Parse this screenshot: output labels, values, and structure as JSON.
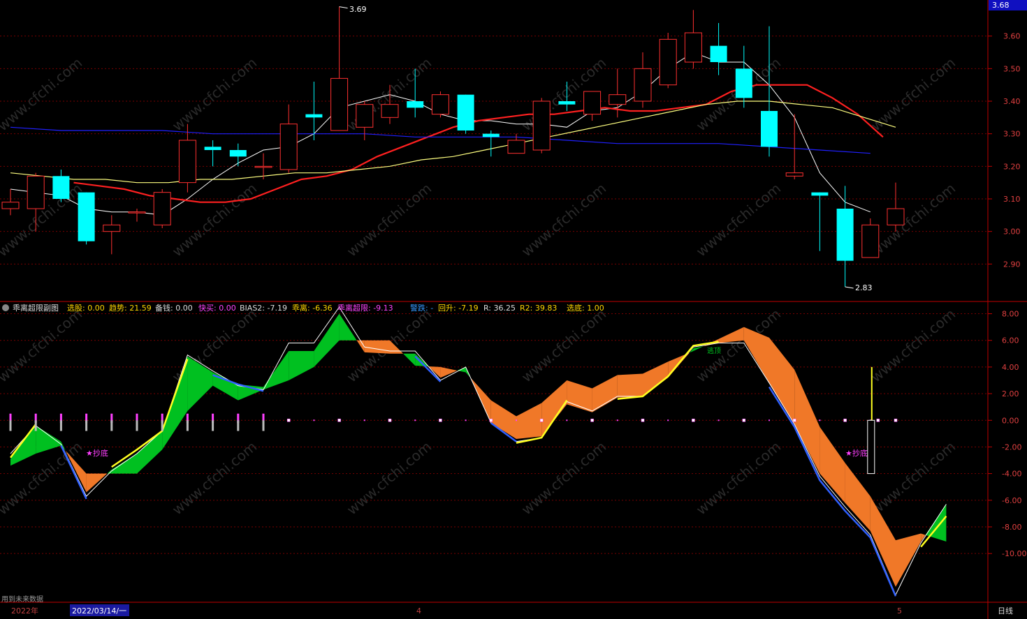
{
  "top_axis": {
    "current_price_box": "3.68",
    "ticks": [
      "3.60",
      "3.50",
      "3.40",
      "3.30",
      "3.20",
      "3.10",
      "3.00",
      "2.90"
    ],
    "tick_values": [
      3.6,
      3.5,
      3.4,
      3.3,
      3.2,
      3.1,
      3.0,
      2.9
    ],
    "ylim": [
      2.8,
      3.7
    ]
  },
  "bottom_axis": {
    "ticks": [
      "8.00",
      "6.00",
      "4.00",
      "2.00",
      "0.00",
      "-2.00",
      "-4.00",
      "-6.00",
      "-8.00",
      "-10.00"
    ],
    "tick_values": [
      8,
      6,
      4,
      2,
      0,
      -2,
      -4,
      -6,
      -8,
      -10
    ],
    "ylim": [
      -13.5,
      8.5
    ]
  },
  "indicator_header": {
    "name": "乖离超限副图",
    "items": [
      {
        "label": "选股:",
        "value": "0.00",
        "color": "#ffd700"
      },
      {
        "label": "趋势:",
        "value": "21.59",
        "color": "#ffd700"
      },
      {
        "label": "备钱:",
        "value": "0.00",
        "color": "#dddddd"
      },
      {
        "label": "快买:",
        "value": "0.00",
        "color": "#ff44ff"
      },
      {
        "label": "BIAS2:",
        "value": "-7.19",
        "color": "#dddddd"
      },
      {
        "label": "乖离:",
        "value": "-6.36",
        "color": "#ffd700"
      },
      {
        "label": "乖离超限:",
        "value": "-9.13",
        "color": "#ff44ff"
      },
      {
        "label": "警跌:",
        "value": "-",
        "color": "#3399ff"
      },
      {
        "label": "回升:",
        "value": "-7.19",
        "color": "#ffd700"
      },
      {
        "label": "R:",
        "value": "36.25",
        "color": "#dddddd"
      },
      {
        "label": "R2:",
        "value": "39.83",
        "color": "#ffd700"
      },
      {
        "label": "选底:",
        "value": "1.00",
        "color": "#ffd700"
      }
    ]
  },
  "annotations": {
    "high_label": "3.69",
    "low_label": "2.83",
    "buy_signal_1": "★抄底",
    "buy_signal_2": "★抄底",
    "top_signal": "逃顶",
    "future_data_note": "用到未来数据",
    "watermark": "www.cfchi.com"
  },
  "time_axis": {
    "year_label": "2022年",
    "cursor_date": "2022/03/14/一",
    "month_label_1": "4",
    "month_label_2": "5",
    "period_label": "日线"
  },
  "colors": {
    "up": "#ff3030",
    "down": "#00ffff",
    "ma5": "#ffffff",
    "ma10": "#ff2020",
    "ma20": "#ffff80",
    "ma60": "#2020ff",
    "orange": "#f07828",
    "green": "#00c020",
    "yellow": "#ffff20",
    "blue": "#3060ff",
    "magenta": "#ff40ff",
    "axis_red": "#c00000",
    "grid": "#7a0000"
  },
  "chart_data": [
    {
      "type": "candlestick",
      "series": [
        {
          "name": "candles",
          "values": [
            {
              "o": 3.07,
              "h": 3.13,
              "l": 3.05,
              "c": 3.09
            },
            {
              "o": 3.07,
              "h": 3.18,
              "l": 3.0,
              "c": 3.17
            },
            {
              "o": 3.17,
              "h": 3.19,
              "l": 3.09,
              "c": 3.1
            },
            {
              "o": 3.12,
              "h": 3.12,
              "l": 2.96,
              "c": 2.97
            },
            {
              "o": 3.0,
              "h": 3.05,
              "l": 2.93,
              "c": 3.02
            },
            {
              "o": 3.06,
              "h": 3.07,
              "l": 3.03,
              "c": 3.06
            },
            {
              "o": 3.02,
              "h": 3.13,
              "l": 3.01,
              "c": 3.12
            },
            {
              "o": 3.15,
              "h": 3.33,
              "l": 3.12,
              "c": 3.28
            },
            {
              "o": 3.26,
              "h": 3.28,
              "l": 3.2,
              "c": 3.25
            },
            {
              "o": 3.25,
              "h": 3.27,
              "l": 3.2,
              "c": 3.23
            },
            {
              "o": 3.2,
              "h": 3.24,
              "l": 3.16,
              "c": 3.2
            },
            {
              "o": 3.19,
              "h": 3.39,
              "l": 3.18,
              "c": 3.33
            },
            {
              "o": 3.36,
              "h": 3.46,
              "l": 3.28,
              "c": 3.35
            },
            {
              "o": 3.31,
              "h": 3.69,
              "l": 3.31,
              "c": 3.47
            },
            {
              "o": 3.32,
              "h": 3.4,
              "l": 3.28,
              "c": 3.39
            },
            {
              "o": 3.35,
              "h": 3.45,
              "l": 3.33,
              "c": 3.39
            },
            {
              "o": 3.4,
              "h": 3.5,
              "l": 3.35,
              "c": 3.38
            },
            {
              "o": 3.36,
              "h": 3.43,
              "l": 3.35,
              "c": 3.42
            },
            {
              "o": 3.42,
              "h": 3.42,
              "l": 3.3,
              "c": 3.31
            },
            {
              "o": 3.3,
              "h": 3.31,
              "l": 3.23,
              "c": 3.29
            },
            {
              "o": 3.24,
              "h": 3.3,
              "l": 3.24,
              "c": 3.28
            },
            {
              "o": 3.25,
              "h": 3.41,
              "l": 3.24,
              "c": 3.4
            },
            {
              "o": 3.4,
              "h": 3.46,
              "l": 3.37,
              "c": 3.39
            },
            {
              "o": 3.36,
              "h": 3.43,
              "l": 3.34,
              "c": 3.43
            },
            {
              "o": 3.39,
              "h": 3.5,
              "l": 3.35,
              "c": 3.42
            },
            {
              "o": 3.4,
              "h": 3.55,
              "l": 3.38,
              "c": 3.5
            },
            {
              "o": 3.45,
              "h": 3.61,
              "l": 3.44,
              "c": 3.59
            },
            {
              "o": 3.52,
              "h": 3.68,
              "l": 3.5,
              "c": 3.61
            },
            {
              "o": 3.57,
              "h": 3.64,
              "l": 3.48,
              "c": 3.52
            },
            {
              "o": 3.5,
              "h": 3.57,
              "l": 3.38,
              "c": 3.41
            },
            {
              "o": 3.37,
              "h": 3.63,
              "l": 3.23,
              "c": 3.26
            },
            {
              "o": 3.17,
              "h": 3.36,
              "l": 3.16,
              "c": 3.18
            },
            {
              "o": 3.12,
              "h": 3.12,
              "l": 2.94,
              "c": 3.11
            },
            {
              "o": 3.07,
              "h": 3.14,
              "l": 2.83,
              "c": 2.91
            },
            {
              "o": 2.92,
              "h": 3.04,
              "l": 2.92,
              "c": 3.02
            },
            {
              "o": 3.02,
              "h": 3.15,
              "l": 3.0,
              "c": 3.07
            }
          ]
        },
        {
          "name": "MA5",
          "values": [
            3.13,
            3.12,
            3.11,
            3.07,
            3.06,
            3.06,
            3.05,
            3.1,
            3.16,
            3.21,
            3.25,
            3.26,
            3.3,
            3.38,
            3.4,
            3.42,
            3.4,
            3.36,
            3.34,
            3.34,
            3.33,
            3.33,
            3.32,
            3.37,
            3.38,
            3.43,
            3.5,
            3.55,
            3.52,
            3.52,
            3.45,
            3.35,
            3.18,
            3.09,
            3.06
          ]
        },
        {
          "name": "MA10",
          "values": [
            3.15,
            3.14,
            3.13,
            3.11,
            3.1,
            3.09,
            3.09,
            3.1,
            3.13,
            3.16,
            3.17,
            3.19,
            3.23,
            3.26,
            3.29,
            3.32,
            3.34,
            3.35,
            3.36,
            3.36,
            3.37,
            3.38,
            3.37,
            3.37,
            3.38,
            3.39,
            3.43,
            3.45,
            3.45,
            3.45,
            3.41,
            3.36,
            3.29
          ]
        },
        {
          "name": "MA20",
          "values": [
            3.18,
            3.17,
            3.16,
            3.16,
            3.15,
            3.15,
            3.16,
            3.16,
            3.17,
            3.18,
            3.18,
            3.19,
            3.2,
            3.22,
            3.23,
            3.25,
            3.27,
            3.29,
            3.31,
            3.33,
            3.35,
            3.37,
            3.39,
            3.4,
            3.4,
            3.39,
            3.38,
            3.35,
            3.32
          ]
        },
        {
          "name": "MA60",
          "values": [
            3.32,
            3.31,
            3.31,
            3.31,
            3.3,
            3.3,
            3.3,
            3.3,
            3.29,
            3.29,
            3.29,
            3.28,
            3.27,
            3.27,
            3.27,
            3.26,
            3.25,
            3.24
          ]
        }
      ],
      "ylim": [
        2.8,
        3.7
      ]
    },
    {
      "type": "area",
      "series": [
        {
          "name": "BIAS2",
          "values": [
            -2.5,
            -0.4,
            -1.8,
            -5.7,
            -3.8,
            -2.5,
            -0.8,
            4.9,
            3.7,
            2.6,
            2.3,
            5.8,
            5.8,
            8.5,
            5.5,
            5.2,
            5.2,
            3.0,
            4.0,
            -0.2,
            -1.6,
            -1.3,
            1.4,
            0.7,
            1.8,
            1.8,
            3.3,
            5.5,
            5.8,
            5.8,
            2.8,
            -0.3,
            -4.2,
            -6.5,
            -8.6,
            -13.1,
            -9.2,
            -6.3
          ]
        },
        {
          "name": "乖离",
          "values": [
            -2.9,
            -0.4,
            -1.6,
            -5.4,
            -3.7,
            -2.5,
            -0.7,
            4.8,
            3.6,
            2.7,
            2.5,
            5.2,
            5.2,
            8.0,
            5.1,
            5.0,
            5.0,
            3.2,
            4.0,
            -0.2,
            -1.4,
            -1.2,
            1.2,
            0.6,
            1.7,
            1.8,
            3.2,
            5.4,
            5.8,
            6.0,
            2.8,
            -0.3,
            -4.0,
            -6.2,
            -8.3,
            -12.5,
            -9.1,
            -6.3
          ]
        },
        {
          "name": "乖离超限",
          "values": [
            -3.4,
            -2.5,
            -1.9,
            -4.0,
            -4.0,
            -4.0,
            -2.2,
            0.7,
            2.6,
            1.5,
            2.3,
            3.0,
            4.0,
            6.0,
            6.0,
            6.0,
            4.1,
            4.0,
            3.6,
            1.5,
            0.3,
            1.3,
            3.0,
            2.4,
            3.4,
            3.5,
            4.4,
            5.2,
            6.1,
            7.0,
            6.2,
            3.8,
            -0.5,
            -3.2,
            -5.7,
            -9.0,
            -8.5,
            -9.1
          ]
        },
        {
          "name": "回升",
          "values": [
            -2.8,
            -0.3,
            null,
            null,
            -3.5,
            -2.2,
            -0.8,
            4.6,
            null,
            null,
            null,
            null,
            null,
            null,
            null,
            null,
            null,
            null,
            null,
            null,
            -1.7,
            -1.3,
            1.5,
            null,
            1.6,
            1.8,
            3.3,
            5.6,
            5.9,
            null,
            null,
            null,
            null,
            null,
            null,
            null,
            -9.5,
            -7.2
          ]
        },
        {
          "name": "警跌",
          "values": [
            null,
            null,
            -1.9,
            -5.9,
            null,
            null,
            null,
            null,
            3.4,
            2.7,
            2.2,
            null,
            null,
            null,
            null,
            null,
            4.8,
            2.9,
            null,
            -0.2,
            -1.6,
            null,
            null,
            null,
            null,
            null,
            null,
            null,
            null,
            null,
            2.5,
            -0.5,
            -4.5,
            -6.8,
            -8.8,
            -13.2,
            null,
            null
          ]
        }
      ],
      "ylim": [
        -13.5,
        8.5
      ]
    }
  ]
}
